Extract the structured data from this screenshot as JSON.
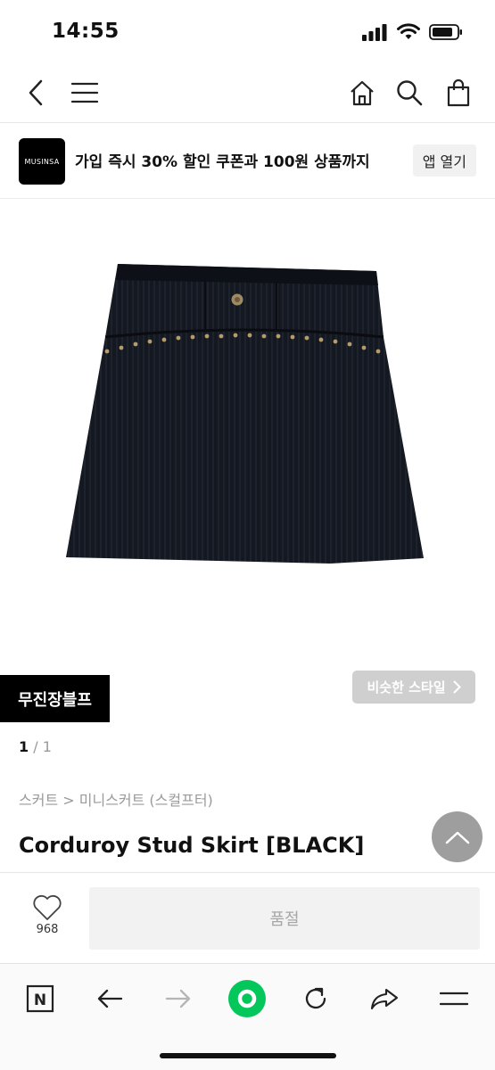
{
  "status": {
    "time": "14:55"
  },
  "nav": {
    "back_icon": "chevron-left-icon",
    "menu_icon": "hamburger-icon",
    "home_icon": "home-icon",
    "search_icon": "search-icon",
    "bag_icon": "shopping-bag-icon"
  },
  "promo": {
    "logo_text": "MUSINSA",
    "message": "가입 즉시 30% 할인 쿠폰과 100원 상품까지",
    "open_app_label": "앱 열기"
  },
  "product": {
    "brand": "무진장블프",
    "similar_style_label": "비슷한 스타일",
    "pager_current": "1",
    "pager_total": " / 1",
    "breadcrumb": "스커트 > 미니스커트 (스컬프터)",
    "title": "Corduroy Stud Skirt [BLACK]"
  },
  "actions": {
    "like_count": "968",
    "soldout_label": "품절"
  },
  "browser": {
    "n_label": "N"
  },
  "colors": {
    "brand_black": "#000000",
    "green_accent": "#03c75a",
    "soldout_text": "#a6a6a6",
    "similar_button_bg": "#cfcfcf"
  }
}
